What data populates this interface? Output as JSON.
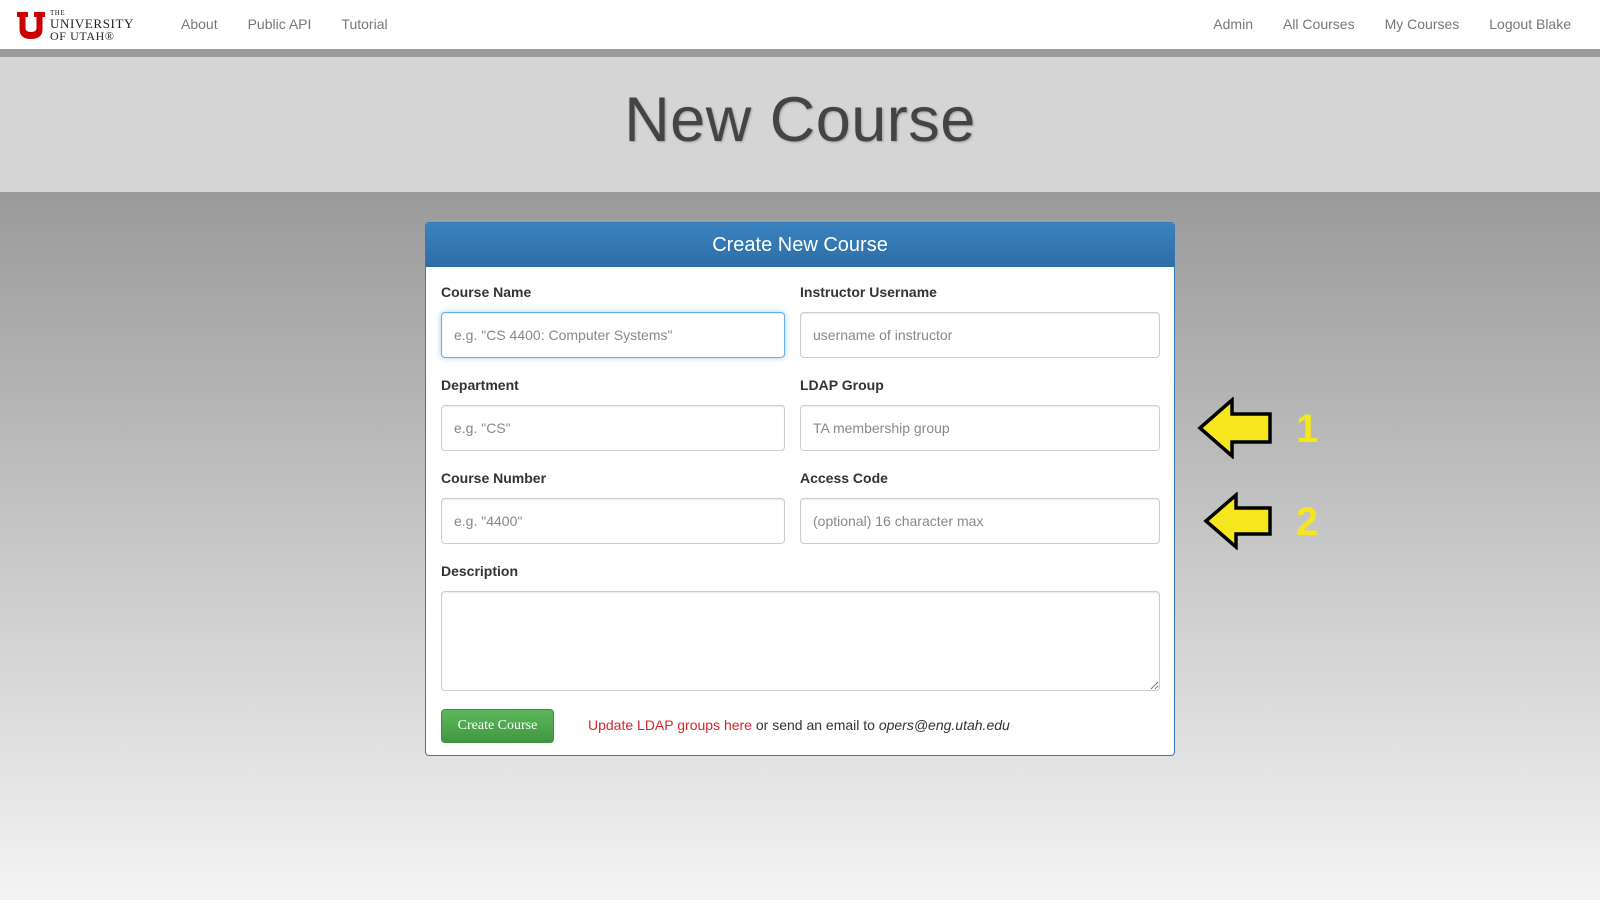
{
  "navbar": {
    "logo": {
      "line0": "THE",
      "line1": "UNIVERSITY",
      "line2": "OF UTAH®"
    },
    "left_links": [
      "About",
      "Public API",
      "Tutorial"
    ],
    "right_links": [
      "Admin",
      "All Courses",
      "My Courses",
      "Logout Blake"
    ]
  },
  "page": {
    "title": "New Course"
  },
  "panel": {
    "heading": "Create New Course",
    "fields": {
      "course_name": {
        "label": "Course Name",
        "placeholder": "e.g. \"CS 4400: Computer Systems\"",
        "value": ""
      },
      "instructor_username": {
        "label": "Instructor Username",
        "placeholder": "username of instructor",
        "value": ""
      },
      "department": {
        "label": "Department",
        "placeholder": "e.g. \"CS\"",
        "value": ""
      },
      "ldap_group": {
        "label": "LDAP Group",
        "placeholder": "TA membership group",
        "value": ""
      },
      "course_number": {
        "label": "Course Number",
        "placeholder": "e.g. \"4400\"",
        "value": ""
      },
      "access_code": {
        "label": "Access Code",
        "placeholder": "(optional) 16 character max",
        "value": ""
      },
      "description": {
        "label": "Description",
        "value": ""
      }
    },
    "submit_label": "Create Course",
    "help": {
      "link_text": "Update LDAP groups here",
      "middle_text": " or send an email to ",
      "email": "opers@eng.utah.edu"
    }
  },
  "annotations": {
    "arrow_color": "#f5e61e",
    "markers": [
      "1",
      "2"
    ]
  },
  "colors": {
    "brand_red": "#cc0000",
    "primary": "#337ab7",
    "success": "#5cb85c",
    "link_red": "#d9242f"
  }
}
